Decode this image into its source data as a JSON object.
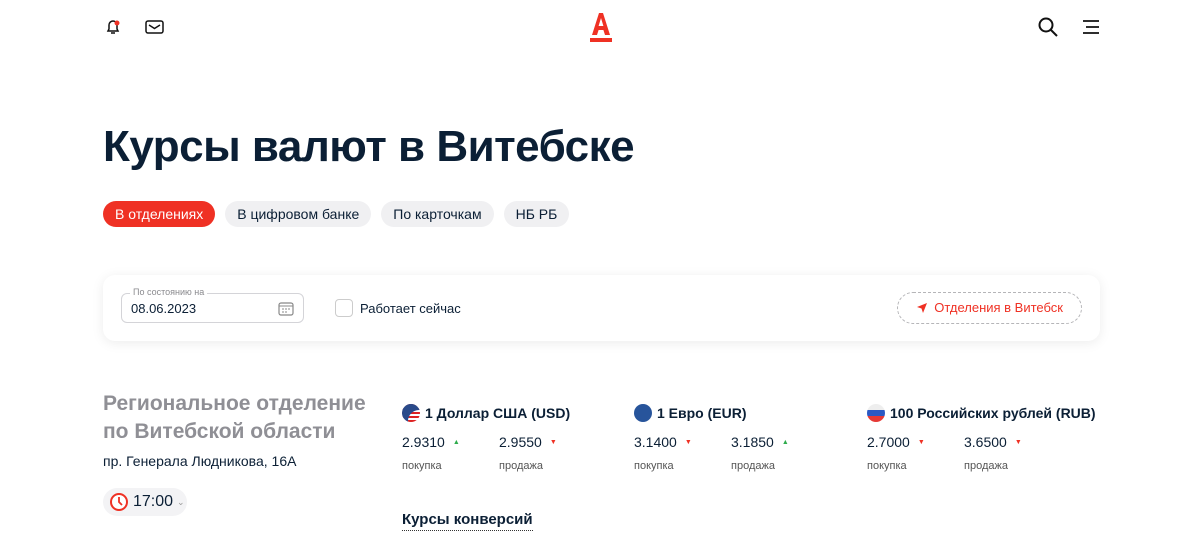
{
  "header": {
    "logo": "А"
  },
  "title": "Курсы валют в Витебске",
  "tabs": [
    {
      "label": "В отделениях",
      "active": true
    },
    {
      "label": "В цифровом банке"
    },
    {
      "label": "По карточкам"
    },
    {
      "label": "НБ РБ"
    }
  ],
  "filter": {
    "date_label": "По состоянию на",
    "date_value": "08.06.2023",
    "open_now": "Работает сейчас",
    "branches_button": "Отделения в Витебск"
  },
  "office": {
    "name_line1": "Региональное отделение",
    "name_line2": "по Витебской области",
    "address": "пр. Генерала Людникова, 16А",
    "time": "17:00"
  },
  "currencies": [
    {
      "name": "1 Доллар США (USD)",
      "flag": "us",
      "buy": "2.9310",
      "buy_dir": "up",
      "sell": "2.9550",
      "sell_dir": "down"
    },
    {
      "name": "1 Евро (EUR)",
      "flag": "eu",
      "buy": "3.1400",
      "buy_dir": "down",
      "sell": "3.1850",
      "sell_dir": "up"
    },
    {
      "name": "100 Российских рублей (RUB)",
      "flag": "ru",
      "buy": "2.7000",
      "buy_dir": "down",
      "sell": "3.6500",
      "sell_dir": "down"
    }
  ],
  "labels": {
    "buy": "покупка",
    "sell": "продажа"
  },
  "conversion": "Курсы конверсий",
  "colors": {
    "accent": "#ef3124",
    "up": "#2eac4c"
  }
}
